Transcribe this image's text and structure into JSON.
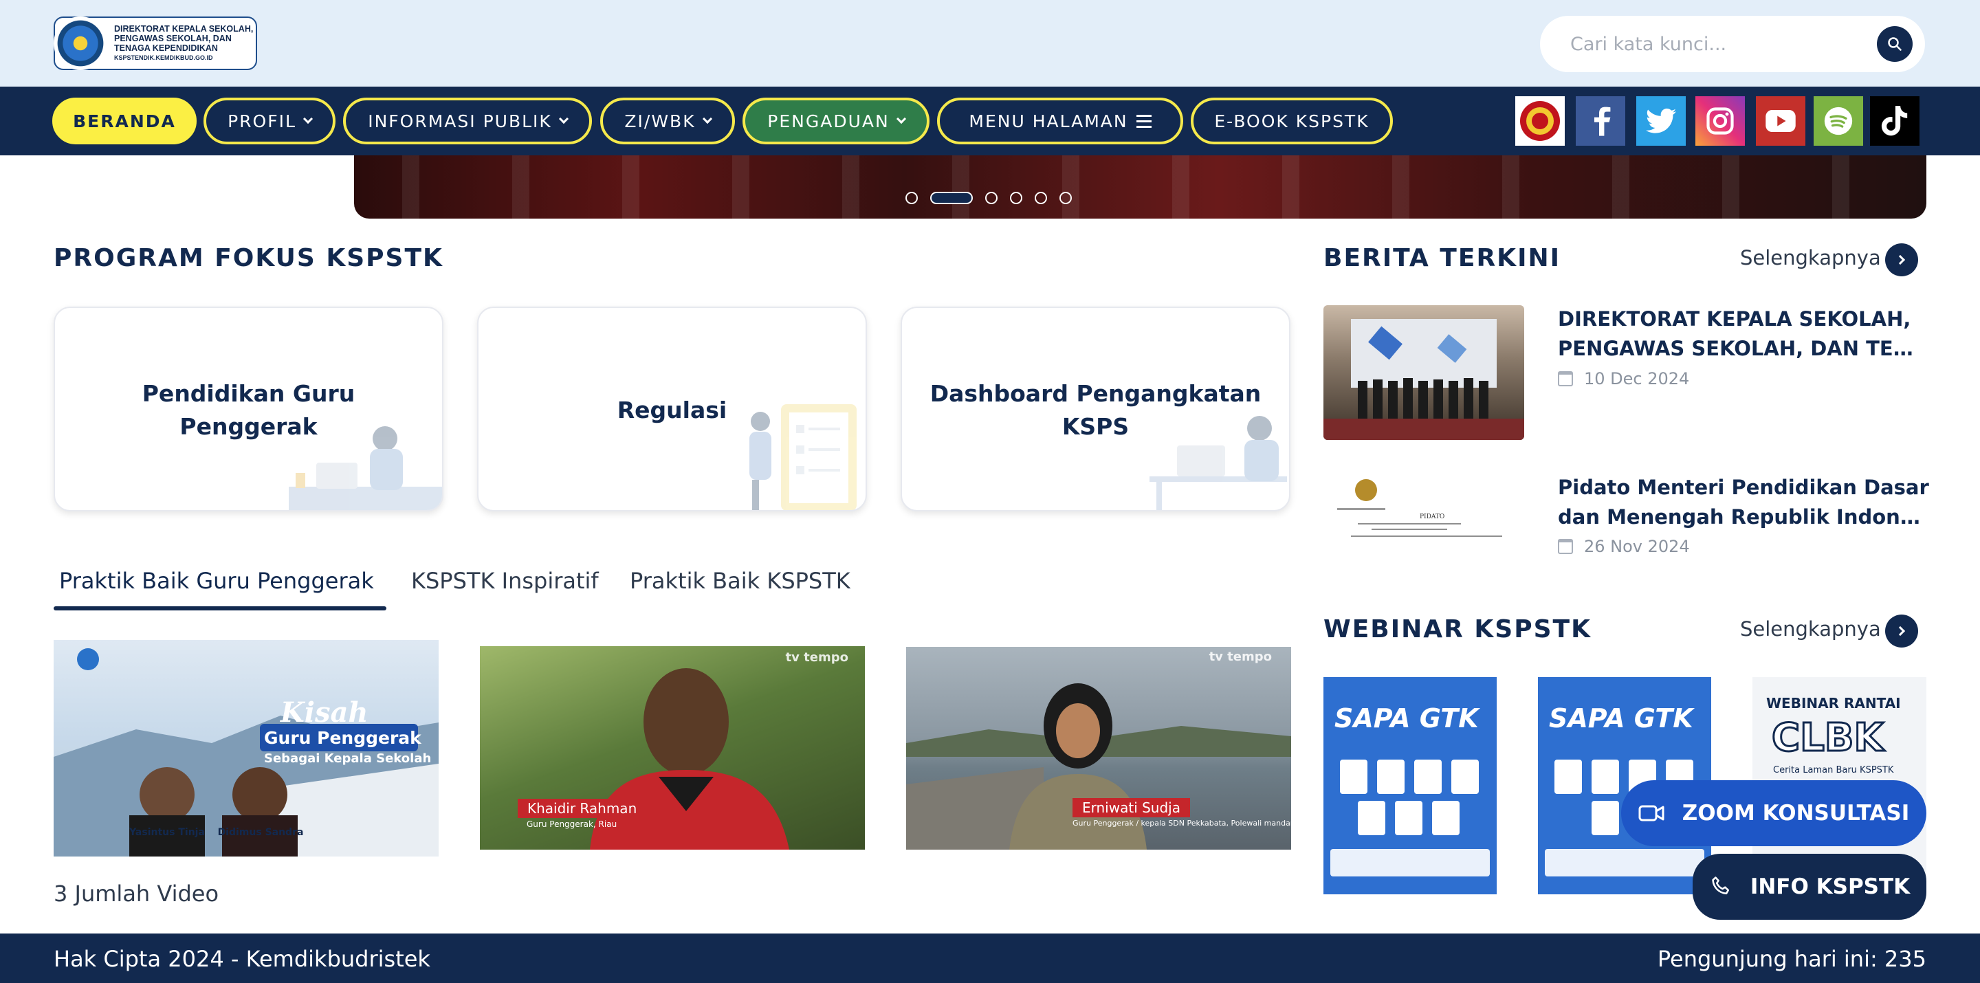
{
  "logo": {
    "line1": "DIREKTORAT KEPALA SEKOLAH,",
    "line2": "PENGAWAS SEKOLAH, DAN",
    "line3": "TENAGA KEPENDIDIKAN",
    "url": "KSPSTENDIK.KEMDIKBUD.GO.ID"
  },
  "search": {
    "placeholder": "Cari kata kunci..."
  },
  "nav": {
    "home": "BERANDA",
    "profil": "PROFIL",
    "informasi": "INFORMASI PUBLIK",
    "zi": "ZI/WBK",
    "pengaduan": "PENGADUAN",
    "menu": "MENU HALAMAN",
    "ebook": "E-BOOK KSPSTK"
  },
  "social": [
    "emblem-icon",
    "facebook-icon",
    "twitter-icon",
    "instagram-icon",
    "youtube-icon",
    "spotify-icon",
    "tiktok-icon"
  ],
  "carousel": {
    "slides": 6,
    "active": 2
  },
  "program": {
    "title": "PROGRAM FOKUS KSPSTK",
    "cards": [
      {
        "label": "Pendidikan Guru Penggerak"
      },
      {
        "label": "Regulasi"
      },
      {
        "label": "Dashboard Pengangkatan KSPS"
      }
    ]
  },
  "tabs": [
    "Praktik Baik Guru Penggerak",
    "KSPSTK Inspiratif",
    "Praktik Baik KSPSTK"
  ],
  "videos": {
    "v1": {
      "title1": "Kisah",
      "title2": "Guru Penggerak",
      "title3": "Sebagai Kepala Sekolah",
      "person1": "Yasintus Tinja",
      "person2": "Didimus Sandra"
    },
    "v2": {
      "watermark": "tv tempo",
      "name": "Khaidir Rahman",
      "role": "Guru Penggerak, Riau"
    },
    "v3": {
      "watermark": "tv tempo",
      "name": "Erniwati Sudja",
      "role": "Guru Penggerak / kepala SDN Pekkabata, Polewali mandar"
    }
  },
  "video_count": "3 Jumlah Video",
  "news": {
    "title": "BERITA TERKINI",
    "more": "Selengkapnya",
    "items": [
      {
        "line1": "DIREKTORAT KEPALA SEKOLAH,",
        "line2": "PENGAWAS SEKOLAH, DAN TENAGA...",
        "date": "10 Dec 2024"
      },
      {
        "line1": "Pidato Menteri Pendidikan Dasar",
        "line2": "dan Menengah Republik Indonesia...",
        "date": "26 Nov 2024"
      }
    ],
    "doc_text": "PIDATO"
  },
  "webinar": {
    "title": "WEBINAR KSPSTK",
    "more": "Selengkapnya",
    "p1": "SAPA GTK",
    "p2": "SAPA GTK",
    "p3_title": "WEBINAR RANTAI",
    "p3_big": "CLBK",
    "p3_sub": "Cerita Laman Baru KSPSTK"
  },
  "float": {
    "zoom": "ZOOM KONSULTASI",
    "info": "INFO KSPSTK"
  },
  "footer": {
    "copyright": "Hak Cipta 2024 - Kemdikbudristek",
    "visitors": "Pengunjung hari ini: 235"
  },
  "colors": {
    "navy": "#12294f",
    "yellow": "#fbef44",
    "green": "#2f7d49",
    "header_bg": "#e3eef9"
  }
}
